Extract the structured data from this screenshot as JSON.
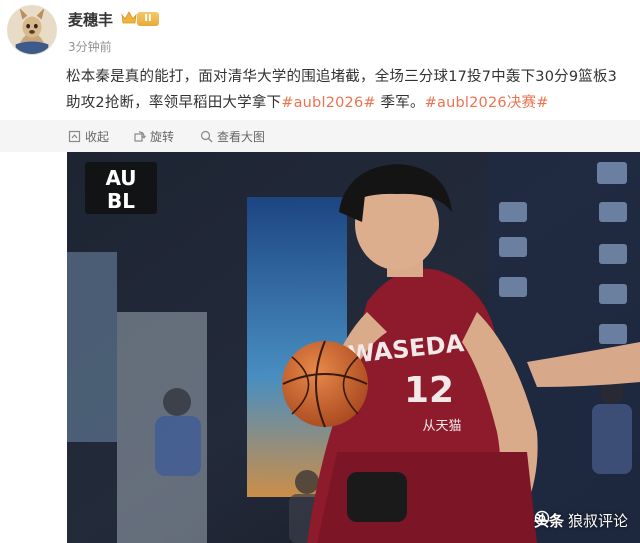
{
  "post": {
    "author": "麦穗丰",
    "vip_level": "II",
    "time": "3分钟前",
    "text_main": "松本秦是真的能打，面对清华大学的围追堵截，全场三分球17投7中轰下30分9篮板3助攻2抢断，率领早稻田大学拿下",
    "tag_1": "#aubl2026#",
    "text_mid": " 季军。",
    "tag_2": "#aubl2026决赛#"
  },
  "toolbar": {
    "collapse": "收起",
    "rotate": "旋转",
    "view_large": "查看大图"
  },
  "photo": {
    "logo_line1": "AU",
    "logo_line2": "BL",
    "jersey_text": "WASEDA",
    "jersey_number": "12",
    "jersey_sponsor": "从天猫",
    "watermark_brand": "头条",
    "watermark_handle": "狼叔评论"
  },
  "colors": {
    "tag": "#eb7350",
    "toolbar_bg": "#f5f5f5",
    "jersey": "#8e1b2c"
  }
}
